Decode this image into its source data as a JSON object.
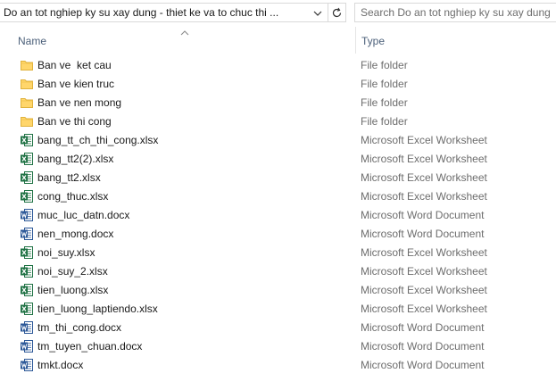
{
  "address_bar": {
    "path": "Do an tot nghiep ky su xay dung - thiet ke va to chuc thi ..."
  },
  "search": {
    "placeholder": "Search Do an tot nghiep ky su xay dung - thiet ke va to chuc thi ..."
  },
  "columns": {
    "name": "Name",
    "type": "Type"
  },
  "files": [
    {
      "name": "Ban ve  ket cau",
      "type": "File folder",
      "icon": "folder-icon"
    },
    {
      "name": "Ban ve kien truc",
      "type": "File folder",
      "icon": "folder-icon"
    },
    {
      "name": "Ban ve nen mong",
      "type": "File folder",
      "icon": "folder-icon"
    },
    {
      "name": "Ban ve thi cong",
      "type": "File folder",
      "icon": "folder-icon"
    },
    {
      "name": "bang_tt_ch_thi_cong.xlsx",
      "type": "Microsoft Excel Worksheet",
      "icon": "excel-icon"
    },
    {
      "name": "bang_tt2(2).xlsx",
      "type": "Microsoft Excel Worksheet",
      "icon": "excel-icon"
    },
    {
      "name": "bang_tt2.xlsx",
      "type": "Microsoft Excel Worksheet",
      "icon": "excel-icon"
    },
    {
      "name": "cong_thuc.xlsx",
      "type": "Microsoft Excel Worksheet",
      "icon": "excel-icon"
    },
    {
      "name": "muc_luc_datn.docx",
      "type": "Microsoft Word Document",
      "icon": "word-icon"
    },
    {
      "name": "nen_mong.docx",
      "type": "Microsoft Word Document",
      "icon": "word-icon"
    },
    {
      "name": "noi_suy.xlsx",
      "type": "Microsoft Excel Worksheet",
      "icon": "excel-icon"
    },
    {
      "name": "noi_suy_2.xlsx",
      "type": "Microsoft Excel Worksheet",
      "icon": "excel-icon"
    },
    {
      "name": "tien_luong.xlsx",
      "type": "Microsoft Excel Worksheet",
      "icon": "excel-icon"
    },
    {
      "name": "tien_luong_laptiendo.xlsx",
      "type": "Microsoft Excel Worksheet",
      "icon": "excel-icon"
    },
    {
      "name": "tm_thi_cong.docx",
      "type": "Microsoft Word Document",
      "icon": "word-icon"
    },
    {
      "name": "tm_tuyen_chuan.docx",
      "type": "Microsoft Word Document",
      "icon": "word-icon"
    },
    {
      "name": "tmkt.docx",
      "type": "Microsoft Word Document",
      "icon": "word-icon"
    }
  ],
  "colors": {
    "header_text": "#4c607a",
    "type_text": "#6d6d6d",
    "folder": "#ffd66b",
    "excel": "#1f7244",
    "word": "#2b5797"
  }
}
